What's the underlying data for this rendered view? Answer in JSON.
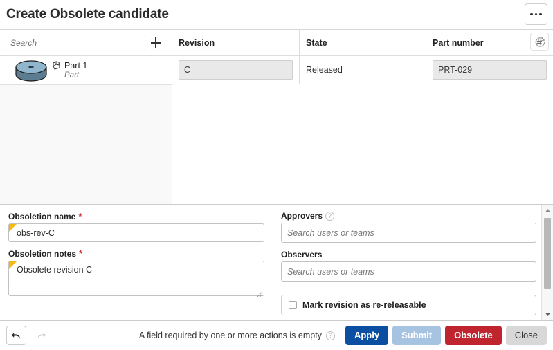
{
  "header": {
    "title": "Create Obsolete candidate",
    "menu_icon": "kebab-menu-icon"
  },
  "tree": {
    "search_placeholder": "Search",
    "search_value": "",
    "add_icon": "plus-icon",
    "items": [
      {
        "name": "Part 1",
        "type": "Part",
        "icon": "part-icon",
        "thumbnail": "cylinder-part-thumbnail"
      }
    ]
  },
  "table": {
    "columns": [
      "Revision",
      "State",
      "Part number"
    ],
    "regenerate_icon": "hash-refresh-icon",
    "rows": [
      {
        "revision": "C",
        "state": "Released",
        "part_number": "PRT-029"
      }
    ]
  },
  "form": {
    "left": {
      "obsoletion_name_label": "Obsoletion name",
      "obsoletion_name_required": "*",
      "obsoletion_name_value": "obs-rev-C",
      "obsoletion_notes_label": "Obsoletion notes",
      "obsoletion_notes_required": "*",
      "obsoletion_notes_value": "Obsolete revision C"
    },
    "right": {
      "approvers_label": "Approvers",
      "approvers_help_icon": "help-icon",
      "approvers_placeholder": "Search users or teams",
      "approvers_value": "",
      "observers_label": "Observers",
      "observers_placeholder": "Search users or teams",
      "observers_value": "",
      "rereleasable_label": "Mark revision as re-releasable",
      "rereleasable_checked": false
    },
    "scrollbar": {
      "up_icon": "scroll-up-arrow-icon",
      "down_icon": "scroll-down-arrow-icon"
    }
  },
  "footer": {
    "undo_icon": "undo-arrow-icon",
    "redo_icon": "redo-arrow-icon",
    "status_message": "A field required by one or more actions is empty",
    "status_help_icon": "help-icon",
    "apply_label": "Apply",
    "submit_label": "Submit",
    "obsolete_label": "Obsolete",
    "close_label": "Close"
  },
  "colors": {
    "apply": "#0b4ea2",
    "submit": "#a7c3e2",
    "obsolete": "#c0252f",
    "close": "#d8d8d8",
    "required_marker": "#d03030",
    "field_flag": "#f5b915"
  }
}
